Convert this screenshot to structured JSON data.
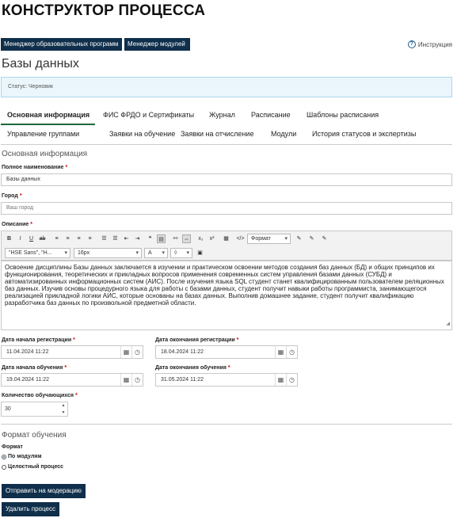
{
  "page_title": "КОНСТРУКТОР ПРОЦЕССА",
  "top_buttons": {
    "programs": "Менеджер образовательных программ",
    "modules": "Менеджер модулей"
  },
  "help_label": "Инструкция",
  "heading": "Базы данных",
  "status_text": "Статус: Черновик",
  "tabs": [
    "Основная информация",
    "ФИС ФРДО и Сертификаты",
    "Журнал",
    "Расписание",
    "Шаблоны расписания",
    "Управление группами",
    "Заявки на обучение",
    "Заявки на отчисление",
    "Модули",
    "История статусов и экспертизы"
  ],
  "section_main": "Основная информация",
  "full_name": {
    "label": "Полное наименование",
    "value": "Базы данных"
  },
  "city": {
    "label": "Город",
    "placeholder": "Ваш город"
  },
  "description": {
    "label": "Описание",
    "font_family": "\"HSE Sans\", \"H...",
    "font_size": "16px",
    "format_label": "Формат",
    "text": "Освоение дисциплины Базы данных заключается в изучении и практическом освоении методов создания баз данных (БД) и общих принципов их функционирования, теоретических и прикладных вопросов применения современных систем управления базами данных (СУБД) и автоматизированных информационных систем (АИС). После изучения языка SQL студент станет квалифицированным пользователем реляционных баз данных. Изучив основы процедурного языка для работы с базами данных, студент получит навыки работы программиста, занимающегося реализацией прикладной логики АИС, которые основаны на базах данных. Выполнив домашнее задание, студент получит квалификацию разработчика баз данных по произвольной предметной области."
  },
  "dates": {
    "reg_start": {
      "label": "Дата начала регистрации",
      "value": "11.04.2024 11:22"
    },
    "reg_end": {
      "label": "Дата окончания регистрации",
      "value": "18.04.2024 11:22"
    },
    "study_start": {
      "label": "Дата начала обучения",
      "value": "19.04.2024 11:22"
    },
    "study_end": {
      "label": "Дата окончания обучения",
      "value": "31.05.2024 11:22"
    }
  },
  "students": {
    "label": "Количество обучающихся",
    "value": "30"
  },
  "section_format": "Формат обучения",
  "format": {
    "label": "Формат",
    "options": [
      "По модулям",
      "Целостный процесс"
    ],
    "selected": 0
  },
  "actions": {
    "submit": "Отправить на модерацию",
    "delete": "Удалить процесс"
  }
}
